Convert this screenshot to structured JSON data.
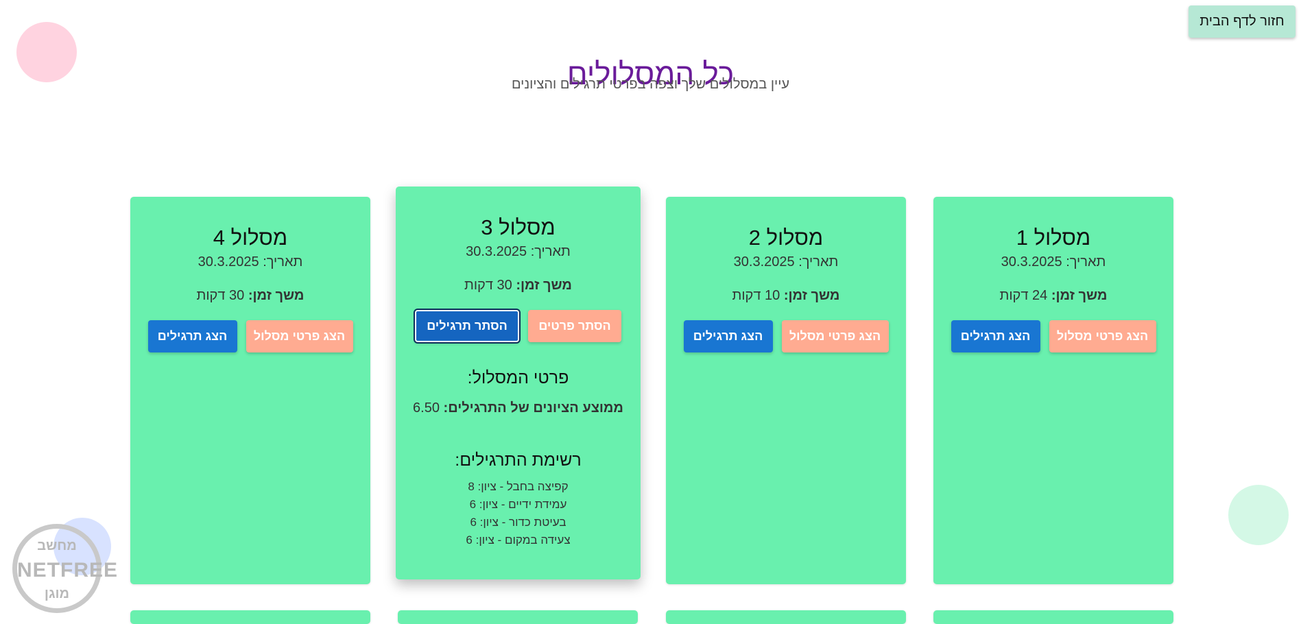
{
  "home_button": "חזור לדף הבית",
  "header": {
    "title": "כל המסלולים",
    "subtitle": "עיין במסלולים שלך וצפה בפרטי תרגילים והציונים"
  },
  "labels": {
    "date_prefix": "תאריך:",
    "duration_prefix": "משך זמן:",
    "show_details": "הצג פרטי מסלול",
    "hide_details": "הסתר פרטים",
    "show_exercises": "הצג תרגילים",
    "hide_exercises": "הסתר תרגילים",
    "details_title": "פרטי המסלול:",
    "avg_label": "ממוצע הציונים של התרגילים:",
    "exercises_title": "רשימת התרגילים:"
  },
  "routes": [
    {
      "title": "מסלול 1",
      "date": "30.3.2025",
      "duration": "24 דקות"
    },
    {
      "title": "מסלול 2",
      "date": "30.3.2025",
      "duration": "10 דקות"
    },
    {
      "title": "מסלול 3",
      "date": "30.3.2025",
      "duration": "30 דקות",
      "average": "6.50",
      "exercises": [
        "קפיצה בחבל - ציון: 8",
        "עמידת ידיים - ציון: 6",
        "בעיטת כדור - ציון: 6",
        "צעידה במקום - ציון: 6"
      ]
    },
    {
      "title": "מסלול 4",
      "date": "30.3.2025",
      "duration": "30 דקות"
    }
  ],
  "watermark": {
    "line1": "מחשב",
    "line2": "NETFREE",
    "line3": "מוגן"
  },
  "colors": {
    "card": "#69f0ae",
    "title": "#6a1b9a",
    "btn_orange": "#ffab91",
    "btn_blue": "#1976d2",
    "home_btn": "#b6e8d5"
  }
}
